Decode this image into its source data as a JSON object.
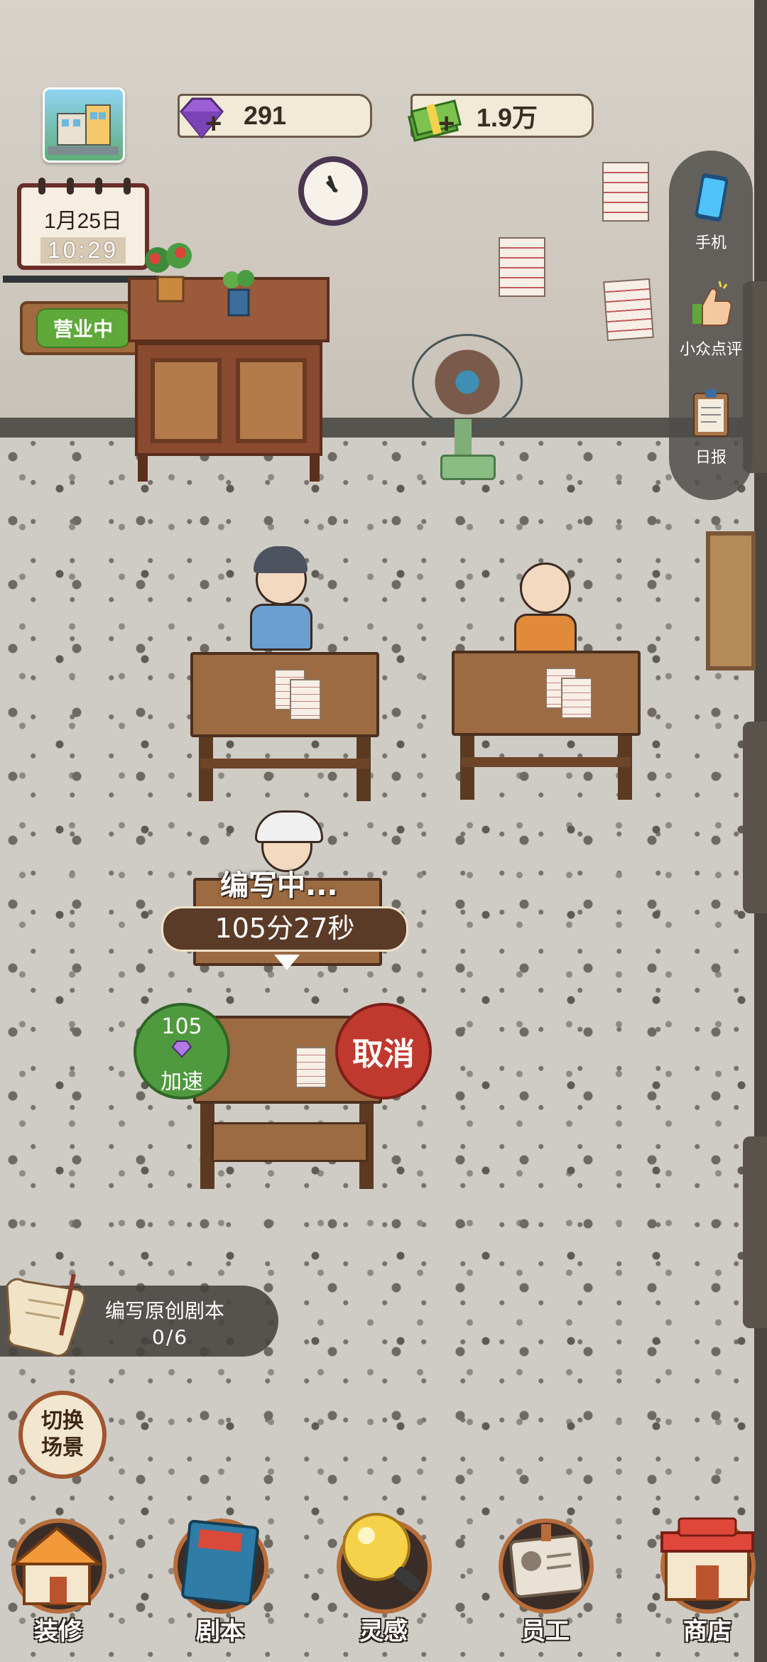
{
  "hud": {
    "gems": "291",
    "cash": "1.9万",
    "plus": "+"
  },
  "calendar": {
    "date": "1月25日",
    "time": "10:29"
  },
  "status_sign": "营业中",
  "side_menu": [
    {
      "label": "手机",
      "icon": "phone-icon"
    },
    {
      "label": "小众点评",
      "icon": "thumbs-up-icon"
    },
    {
      "label": "日报",
      "icon": "clipboard-icon"
    }
  ],
  "progress": {
    "status": "编写中...",
    "timer": "105分27秒",
    "speedup_cost": "105",
    "speedup_label": "加速",
    "cancel_label": "取消"
  },
  "task": {
    "title": "编写原创剧本",
    "progress": "0/6"
  },
  "switch_scene": [
    "切换",
    "场景"
  ],
  "bottom_nav": [
    {
      "label": "装修",
      "icon": "house-icon"
    },
    {
      "label": "剧本",
      "icon": "script-book-icon"
    },
    {
      "label": "灵感",
      "icon": "lightbulb-icon"
    },
    {
      "label": "员工",
      "icon": "badge-icon"
    },
    {
      "label": "商店",
      "icon": "shop-icon"
    }
  ],
  "colors": {
    "gem": "#9b5fd6",
    "cash": "#5fa83a",
    "speedup": "#4f9a3e",
    "cancel": "#c0392f",
    "nav_ring": "#b86d3a"
  }
}
